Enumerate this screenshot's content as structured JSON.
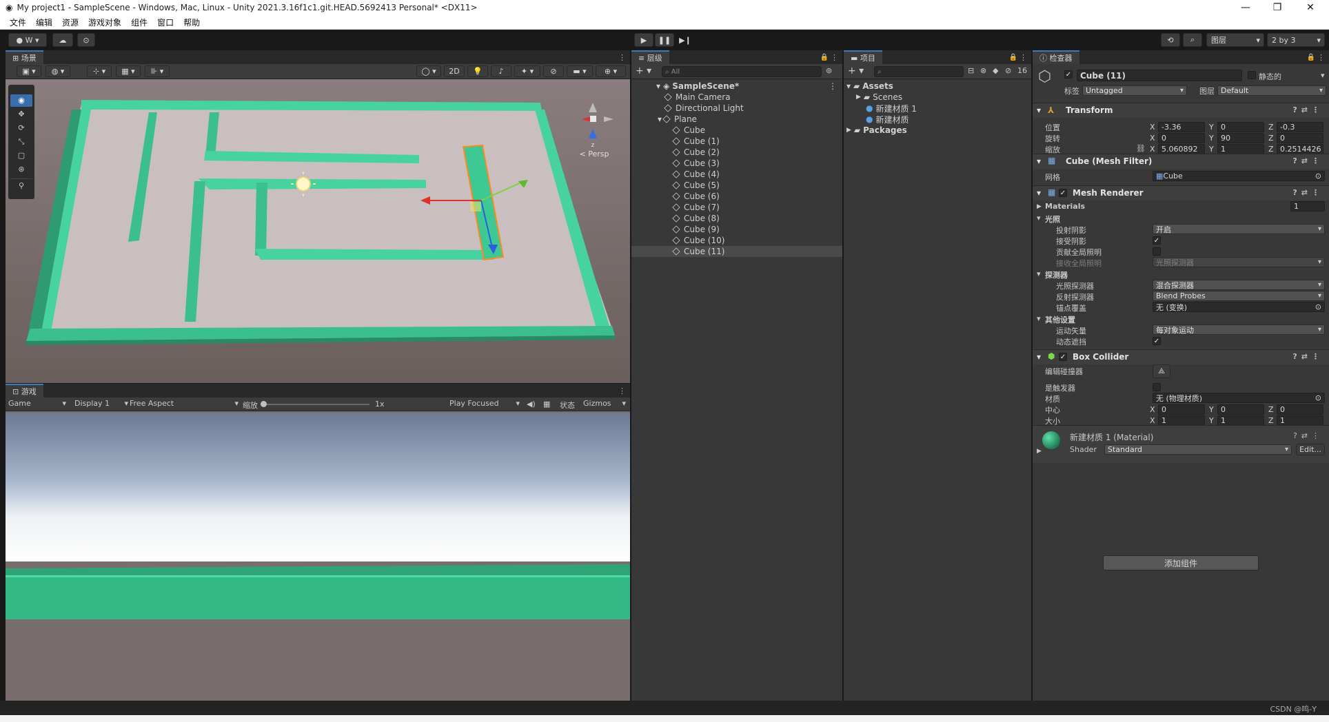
{
  "window": {
    "title": "My project1 - SampleScene - Windows, Mac, Linux - Unity 2021.3.16f1c1.git.HEAD.5692413 Personal* <DX11>",
    "controls": [
      "—",
      "❐",
      "✕"
    ]
  },
  "menu": [
    "文件",
    "编辑",
    "资源",
    "游戏对象",
    "组件",
    "窗口",
    "帮助"
  ],
  "toolbar": {
    "account": "W",
    "layers_label": "图层",
    "layout_label": "2 by 3"
  },
  "scene": {
    "tab": "场景",
    "mode_2d": "2D",
    "persp": "< Persp",
    "axis_z": "z"
  },
  "game": {
    "tab": "游戏",
    "mode": "Game",
    "display": "Display 1",
    "aspect": "Free Aspect",
    "scale_label": "缩放",
    "scale_value": "1x",
    "play_focused": "Play Focused",
    "stats": "状态",
    "gizmos": "Gizmos"
  },
  "hierarchy": {
    "tab": "层级",
    "search_placeholder": "All",
    "scene_name": "SampleScene*",
    "items": [
      {
        "name": "Main Camera",
        "depth": 1
      },
      {
        "name": "Directional Light",
        "depth": 1
      },
      {
        "name": "Plane",
        "depth": 1
      },
      {
        "name": "Cube",
        "depth": 2
      },
      {
        "name": "Cube (1)",
        "depth": 2
      },
      {
        "name": "Cube (2)",
        "depth": 2
      },
      {
        "name": "Cube (3)",
        "depth": 2
      },
      {
        "name": "Cube (4)",
        "depth": 2
      },
      {
        "name": "Cube (5)",
        "depth": 2
      },
      {
        "name": "Cube (6)",
        "depth": 2
      },
      {
        "name": "Cube (7)",
        "depth": 2
      },
      {
        "name": "Cube (8)",
        "depth": 2
      },
      {
        "name": "Cube (9)",
        "depth": 2
      },
      {
        "name": "Cube (10)",
        "depth": 2
      },
      {
        "name": "Cube (11)",
        "depth": 2,
        "selected": true
      }
    ]
  },
  "project": {
    "tab": "项目",
    "badge": "16",
    "assets": "Assets",
    "scenes": "Scenes",
    "mat1": "新建材质 1",
    "mat2": "新建材质",
    "packages": "Packages"
  },
  "inspector": {
    "tab": "检查器",
    "object_name": "Cube (11)",
    "static_label": "静态的",
    "tag_label": "标签",
    "tag_value": "Untagged",
    "layer_label": "图层",
    "layer_value": "Default",
    "transform": {
      "title": "Transform",
      "position_label": "位置",
      "rotation_label": "旋转",
      "scale_label": "缩放",
      "position": {
        "x": "-3.36",
        "y": "0",
        "z": "-0.3"
      },
      "rotation": {
        "x": "0",
        "y": "90",
        "z": "0"
      },
      "scale": {
        "x": "5.060892",
        "y": "1",
        "z": "0.2514426"
      }
    },
    "mesh_filter": {
      "title": "Cube (Mesh Filter)",
      "mesh_label": "网格",
      "mesh_value": "Cube"
    },
    "mesh_renderer": {
      "title": "Mesh Renderer",
      "materials_label": "Materials",
      "materials_count": "1",
      "lighting_header": "光照",
      "cast_shadows_label": "投射阴影",
      "cast_shadows_value": "开启",
      "receive_shadows_label": "接受阴影",
      "contribute_gi_label": "贡献全局照明",
      "receive_gi_label": "接收全局照明",
      "receive_gi_value": "光照探测器",
      "probes_header": "探测器",
      "light_probes_label": "光照探测器",
      "light_probes_value": "混合探测器",
      "reflection_probes_label": "反射探测器",
      "reflection_probes_value": "Blend Probes",
      "anchor_label": "锚点覆盖",
      "anchor_value": "无 (变换)",
      "other_header": "其他设置",
      "motion_vectors_label": "运动矢量",
      "motion_vectors_value": "每对象运动",
      "dynamic_occlusion_label": "动态遮挡"
    },
    "box_collider": {
      "title": "Box Collider",
      "edit_label": "编辑碰撞器",
      "trigger_label": "是触发器",
      "material_label": "材质",
      "material_value": "无 (物理材质)",
      "center_label": "中心",
      "size_label": "大小",
      "center": {
        "x": "0",
        "y": "0",
        "z": "0"
      },
      "size": {
        "x": "1",
        "y": "1",
        "z": "1"
      }
    },
    "material": {
      "title": "新建材质 1 (Material)",
      "shader_label": "Shader",
      "shader_value": "Standard",
      "edit_button": "Edit..."
    },
    "add_component": "添加组件"
  },
  "colors": {
    "wall": "#3cbf8f",
    "floor": "#c9bfc0",
    "sky": "#8fa4c2",
    "accent": "#3a79bb"
  },
  "watermark": "CSDN @鸣-Y"
}
